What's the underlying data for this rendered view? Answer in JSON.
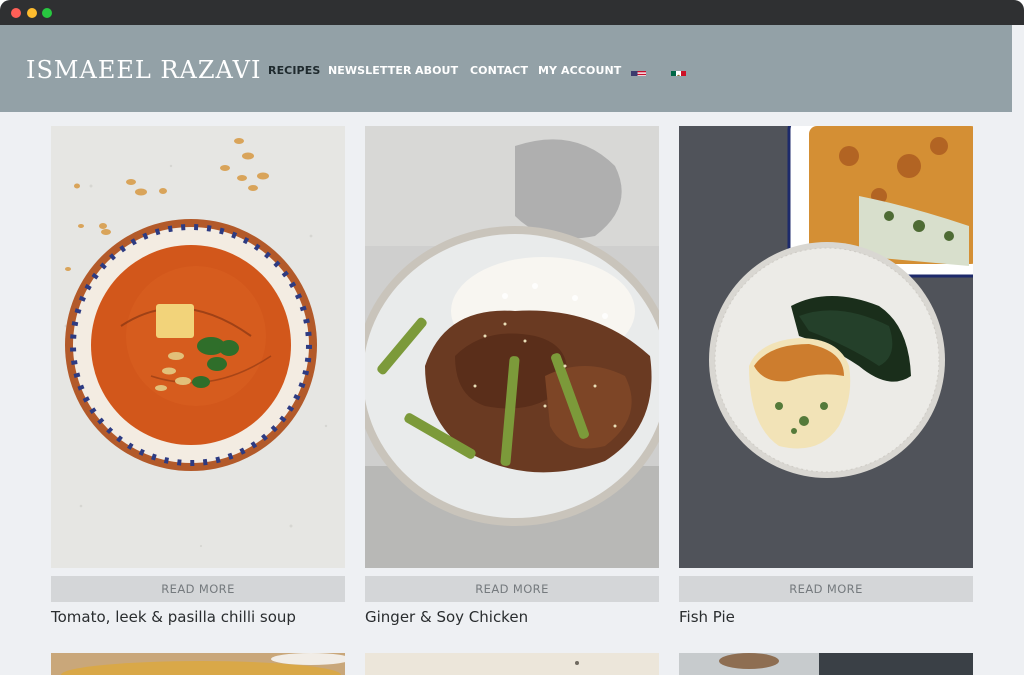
{
  "site": {
    "logo": "ISMAEEL RAZAVI"
  },
  "nav": {
    "items": [
      {
        "label": "RECIPES",
        "active": true
      },
      {
        "label": "NEWSLETTER",
        "active": false
      },
      {
        "label": "ABOUT",
        "active": false
      },
      {
        "label": "CONTACT",
        "active": false
      },
      {
        "label": "MY ACCOUNT",
        "active": false
      }
    ],
    "flags": [
      {
        "icon": "us-flag-icon"
      },
      {
        "icon": "mexico-flag-icon"
      }
    ]
  },
  "recipes": [
    {
      "title": "Tomato, leek & pasilla chilli soup",
      "button": "READ MORE",
      "image": "soup-photo"
    },
    {
      "title": "Ginger & Soy Chicken",
      "button": "READ MORE",
      "image": "chicken-photo"
    },
    {
      "title": "Fish Pie",
      "button": "READ MORE",
      "image": "fish-pie-photo"
    }
  ],
  "colors": {
    "header": "#93a1a7",
    "page_background": "#eef0f3",
    "button_background": "#d4d6d8"
  }
}
